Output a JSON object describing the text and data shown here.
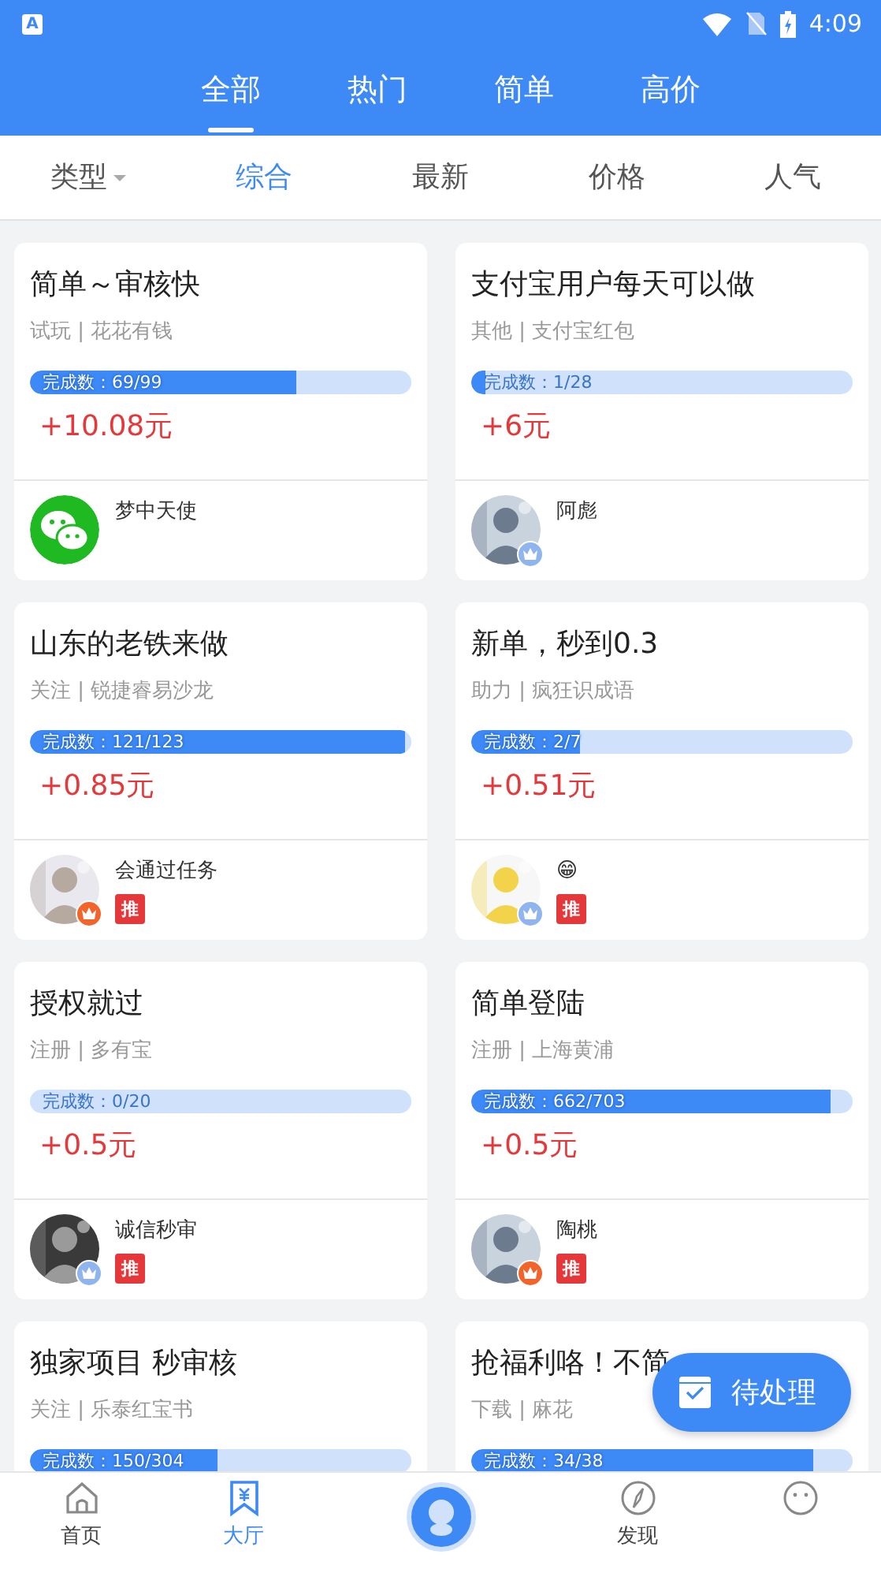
{
  "status_bar": {
    "notification": "A",
    "time": "4:09"
  },
  "top_tabs": [
    {
      "label": "全部",
      "selected": true
    },
    {
      "label": "热门",
      "selected": false
    },
    {
      "label": "简单",
      "selected": false
    },
    {
      "label": "高价",
      "selected": false
    }
  ],
  "filter": {
    "type_label": "类型",
    "sorts": [
      {
        "label": "综合",
        "selected": true
      },
      {
        "label": "最新",
        "selected": false
      },
      {
        "label": "价格",
        "selected": false
      },
      {
        "label": "人气",
        "selected": false
      }
    ]
  },
  "tasks": [
    {
      "title": "简单～审核快",
      "meta": "试玩 | 花花有钱",
      "progress_text": "完成数：69/99",
      "level": 0.697,
      "reward": "+10.08元",
      "user": {
        "avatar": {
          "kind": "chat"
        },
        "name": "梦中天使"
      }
    },
    {
      "title": "支付宝用户每天可以做",
      "meta": "其他 | 支付宝红包",
      "progress_text": "完成数：1/28",
      "level": 0.036,
      "reward": "+6元",
      "user": {
        "crown": {
          "color": "#8fb4ee"
        },
        "name": "阿彪"
      }
    },
    {
      "title": "山东的老铁来做",
      "meta": "关注 | 锐捷睿易沙龙",
      "progress_text": "完成数：121/123",
      "level": 0.984,
      "reward": "+0.85元",
      "user": {
        "crown": {
          "color": "#f2642a"
        },
        "name": "会通过任务",
        "tag": "推"
      }
    },
    {
      "title": "新单，秒到0.3",
      "meta": "助力 | 疯狂识成语",
      "progress_text": "完成数：2/7",
      "level": 0.286,
      "reward": "+0.51元",
      "user": {
        "crown": {
          "color": "#8fb4ee"
        },
        "name": "😁",
        "tag": "推"
      }
    },
    {
      "title": "授权就过",
      "meta": "注册 | 多有宝",
      "progress_text": "完成数：0/20",
      "level": 0,
      "reward": "+0.5元",
      "user": {
        "crown": {
          "color": "#8fb4ee"
        },
        "name": "诚信秒审",
        "tag": "推"
      }
    },
    {
      "title": "简单登陆",
      "meta": "注册 | 上海黄浦",
      "progress_text": "完成数：662/703",
      "level": 0.942,
      "reward": "+0.5元",
      "user": {
        "crown": {
          "color": "#f2642a"
        },
        "name": "陶桃",
        "tag": "推"
      }
    },
    {
      "title": "独家项目 秒审核",
      "meta": "关注 | 乐泰红宝书",
      "progress_text": "完成数：150/304",
      "level": 0.493
    },
    {
      "title": "抢福利咯！不简",
      "meta": "下载 | 麻花",
      "progress_text": "完成数：34/38",
      "level": 0.895
    }
  ],
  "fab": {
    "label": "待处理"
  },
  "bottom_nav": [
    {
      "kind": "home",
      "label": "首页",
      "selected": false
    },
    {
      "kind": "hall",
      "label": "大厅",
      "selected": true
    },
    {
      "kind": "center"
    },
    {
      "kind": "compass",
      "label": "发现",
      "selected": false
    },
    {
      "kind": "smiley",
      "selected": false
    }
  ]
}
